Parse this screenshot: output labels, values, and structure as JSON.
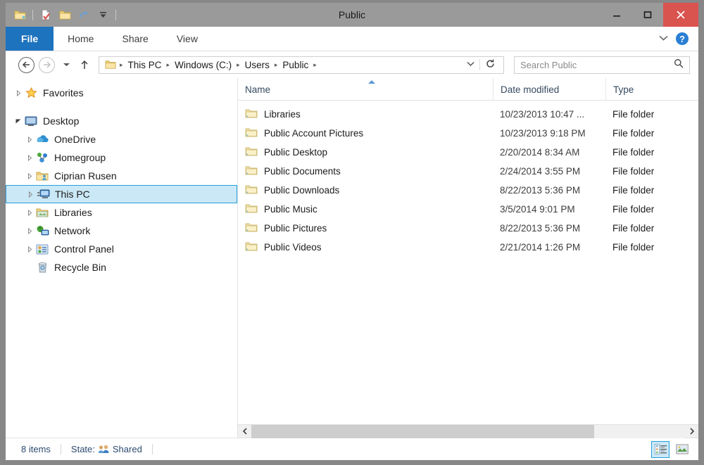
{
  "window": {
    "title": "Public",
    "minimize_label": "–",
    "maximize_label": "❑",
    "close_label": "✕"
  },
  "quick_access": {
    "items": [
      {
        "name": "folder-icon",
        "label": "Public"
      },
      {
        "name": "properties-icon",
        "label": "Properties"
      },
      {
        "name": "new-folder-icon",
        "label": "New folder"
      },
      {
        "name": "redo-icon",
        "label": "Redo"
      },
      {
        "name": "customize-chevron-icon",
        "label": "Customize Quick Access Toolbar"
      }
    ]
  },
  "ribbon": {
    "tabs": [
      {
        "label": "File",
        "active": true
      },
      {
        "label": "Home",
        "active": false
      },
      {
        "label": "Share",
        "active": false
      },
      {
        "label": "View",
        "active": false
      }
    ],
    "expand_label": "⌄",
    "help_label": "?"
  },
  "address": {
    "back_label": "←",
    "forward_label": "→",
    "recent_label": "▾",
    "up_label": "↑",
    "breadcrumbs": [
      "This PC",
      "Windows (C:)",
      "Users",
      "Public"
    ],
    "separator": "▸",
    "dropdown_label": "⌄",
    "refresh_label": "↻"
  },
  "search": {
    "placeholder": "Search Public",
    "icon_label": "⚲"
  },
  "sidebar": {
    "items": [
      {
        "label": "Favorites",
        "icon": "star-icon",
        "arrow": "▹",
        "indent": 0,
        "selected": false
      },
      {
        "label": "Desktop",
        "icon": "desktop-icon",
        "arrow": "▾",
        "indent": 0,
        "selected": false
      },
      {
        "label": "OneDrive",
        "icon": "onedrive-icon",
        "arrow": "▹",
        "indent": 1,
        "selected": false
      },
      {
        "label": "Homegroup",
        "icon": "homegroup-icon",
        "arrow": "▹",
        "indent": 1,
        "selected": false
      },
      {
        "label": "Ciprian Rusen",
        "icon": "user-folder-icon",
        "arrow": "▹",
        "indent": 1,
        "selected": false
      },
      {
        "label": "This PC",
        "icon": "this-pc-icon",
        "arrow": "▹",
        "indent": 1,
        "selected": true
      },
      {
        "label": "Libraries",
        "icon": "libraries-icon",
        "arrow": "▹",
        "indent": 1,
        "selected": false
      },
      {
        "label": "Network",
        "icon": "network-icon",
        "arrow": "▹",
        "indent": 1,
        "selected": false
      },
      {
        "label": "Control Panel",
        "icon": "control-panel-icon",
        "arrow": "▹",
        "indent": 1,
        "selected": false
      },
      {
        "label": "Recycle Bin",
        "icon": "recycle-bin-icon",
        "arrow": "",
        "indent": 1,
        "selected": false
      }
    ]
  },
  "file_list": {
    "columns": [
      "Name",
      "Date modified",
      "Type"
    ],
    "sort_column": "Name",
    "sort_direction": "ascending",
    "rows": [
      {
        "name": "Libraries",
        "date": "10/23/2013 10:47 ...",
        "type": "File folder"
      },
      {
        "name": "Public Account Pictures",
        "date": "10/23/2013 9:18 PM",
        "type": "File folder"
      },
      {
        "name": "Public Desktop",
        "date": "2/20/2014 8:34 AM",
        "type": "File folder"
      },
      {
        "name": "Public Documents",
        "date": "2/24/2014 3:55 PM",
        "type": "File folder"
      },
      {
        "name": "Public Downloads",
        "date": "8/22/2013 5:36 PM",
        "type": "File folder"
      },
      {
        "name": "Public Music",
        "date": "3/5/2014 9:01 PM",
        "type": "File folder"
      },
      {
        "name": "Public Pictures",
        "date": "8/22/2013 5:36 PM",
        "type": "File folder"
      },
      {
        "name": "Public Videos",
        "date": "2/21/2014 1:26 PM",
        "type": "File folder"
      }
    ]
  },
  "scrollbar": {
    "left_label": "‹",
    "right_label": "›"
  },
  "status": {
    "item_count": "8 items",
    "state_label": "State:",
    "state_value": "Shared",
    "details_view_label": "Details view",
    "large_icons_view_label": "Large icons view"
  },
  "colors": {
    "accent": "#1e73be",
    "selection": "#cbe8f6",
    "selection_border": "#26a0da",
    "close_button": "#d9534f",
    "titlebar": "#9a9a9a"
  }
}
